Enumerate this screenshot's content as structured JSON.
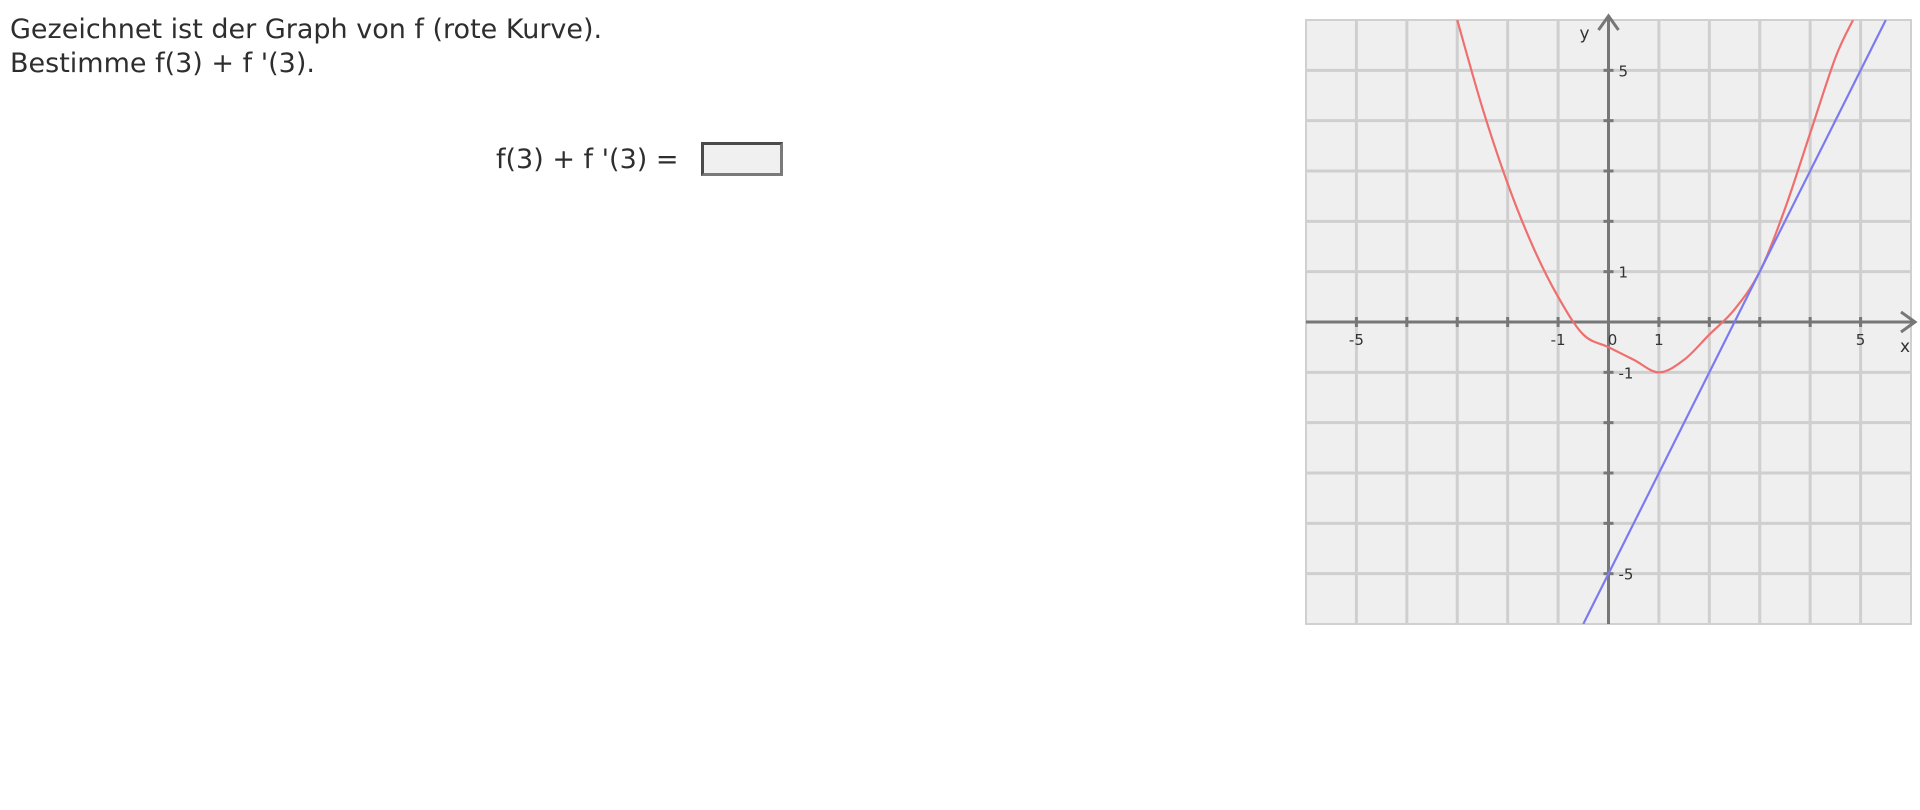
{
  "task": {
    "line1": "Gezeichnet ist der Graph von f (rote Kurve).",
    "line2": "Bestimme f(3) + f '(3)."
  },
  "answer": {
    "label": "f(3) + f '(3) =",
    "value": ""
  },
  "chart_data": {
    "type": "line",
    "xlabel": "x",
    "ylabel": "y",
    "xlim": [
      -6,
      6
    ],
    "ylim": [
      -6,
      6
    ],
    "grid": true,
    "x_tick_labels": [
      {
        "value": -5,
        "text": "-5"
      },
      {
        "value": -1,
        "text": "-1"
      },
      {
        "value": 0,
        "text": "0"
      },
      {
        "value": 1,
        "text": "1"
      },
      {
        "value": 5,
        "text": "5"
      }
    ],
    "y_tick_labels": [
      {
        "value": 5,
        "text": "5"
      },
      {
        "value": 1,
        "text": "1"
      },
      {
        "value": -1,
        "text": "-1"
      },
      {
        "value": -5,
        "text": "-5"
      }
    ],
    "series": [
      {
        "color": "#ef6f6f",
        "x": [
          -3,
          -2.5,
          -2,
          -1.5,
          -1,
          -0.5,
          0,
          0.5,
          1,
          1.5,
          2,
          2.5,
          3,
          3.5,
          4,
          4.5,
          4.85
        ],
        "y": [
          6,
          4.25,
          2.75,
          1.5,
          0.5,
          -0.25,
          -0.5,
          -0.75,
          -1,
          -0.75,
          -0.25,
          0.25,
          1,
          2.25,
          3.75,
          5.25,
          6
        ]
      },
      {
        "color": "#7b7bf0",
        "x": [
          -0.5,
          5.5
        ],
        "y": [
          -6,
          6
        ]
      }
    ]
  }
}
